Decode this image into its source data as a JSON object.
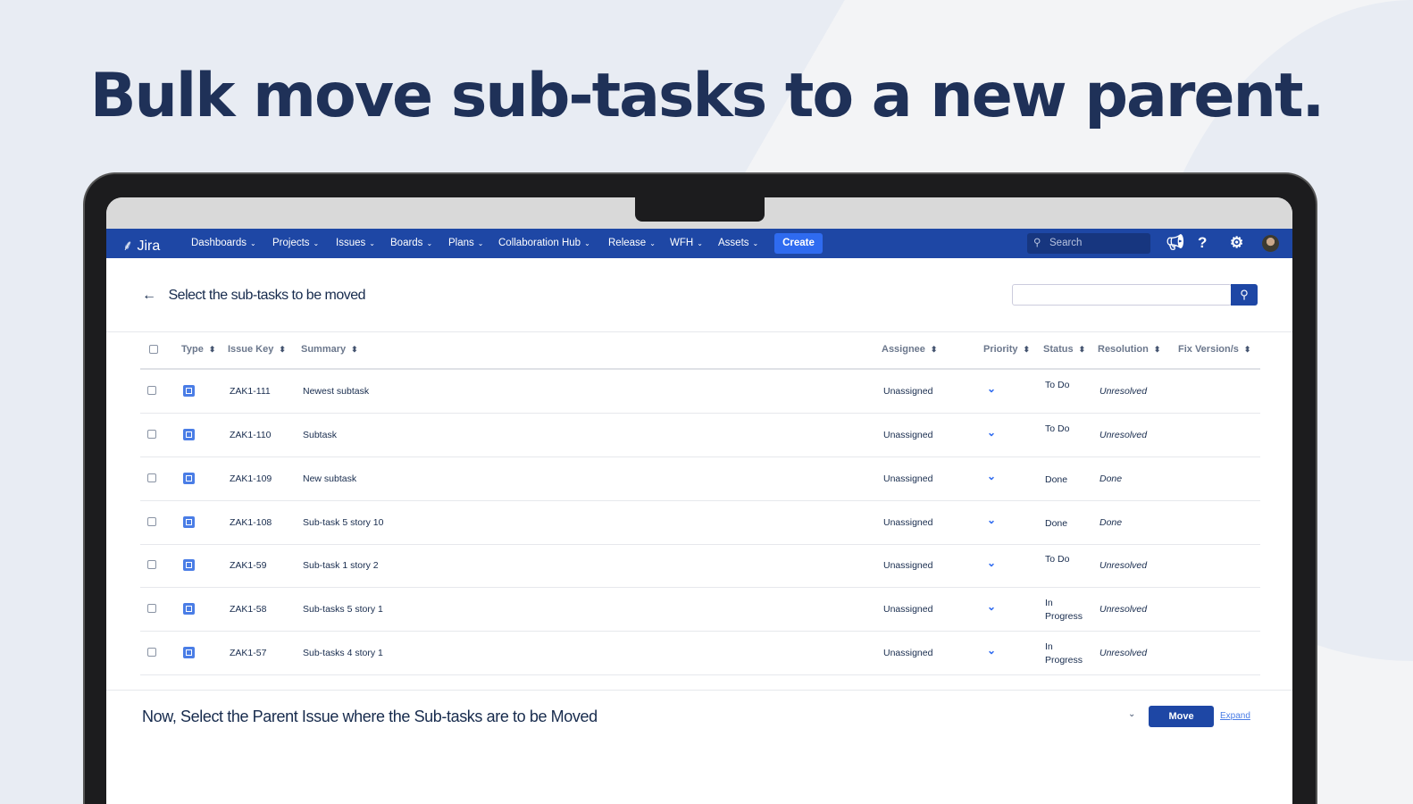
{
  "headline": "Bulk move sub-tasks to a new parent.",
  "nav": {
    "logo": "Jira",
    "items": [
      "Dashboards",
      "Projects",
      "Issues",
      "Boards",
      "Plans",
      "Collaboration Hub",
      "Release",
      "WFH",
      "Assets"
    ],
    "create": "Create",
    "search_placeholder": "Search"
  },
  "page": {
    "title": "Select the sub-tasks to be moved",
    "back_icon": "←"
  },
  "table": {
    "headers": [
      "Type",
      "Issue Key",
      "Summary",
      "Assignee",
      "Priority",
      "Status",
      "Resolution",
      "Fix Version/s"
    ],
    "rows": [
      {
        "key": "ZAK1-111",
        "summary": "Newest subtask",
        "assignee": "Unassigned",
        "status": "To Do",
        "resolution": "Unresolved"
      },
      {
        "key": "ZAK1-110",
        "summary": "Subtask",
        "assignee": "Unassigned",
        "status": "To Do",
        "resolution": "Unresolved"
      },
      {
        "key": "ZAK1-109",
        "summary": "New subtask",
        "assignee": "Unassigned",
        "status": "Done",
        "resolution": "Done"
      },
      {
        "key": "ZAK1-108",
        "summary": "Sub-task 5 story 10",
        "assignee": "Unassigned",
        "status": "Done",
        "resolution": "Done"
      },
      {
        "key": "ZAK1-59",
        "summary": "Sub-task 1 story 2",
        "assignee": "Unassigned",
        "status": "To Do",
        "resolution": "Unresolved"
      },
      {
        "key": "ZAK1-58",
        "summary": "Sub-tasks 5 story 1",
        "assignee": "Unassigned",
        "status": "In Progress",
        "resolution": "Unresolved"
      },
      {
        "key": "ZAK1-57",
        "summary": "Sub-tasks 4 story 1",
        "assignee": "Unassigned",
        "status": "In Progress",
        "resolution": "Unresolved"
      }
    ]
  },
  "bottom": {
    "title": "Now, Select the Parent Issue where the Sub-tasks are to be Moved",
    "move": "Move",
    "expand": "Expand"
  }
}
